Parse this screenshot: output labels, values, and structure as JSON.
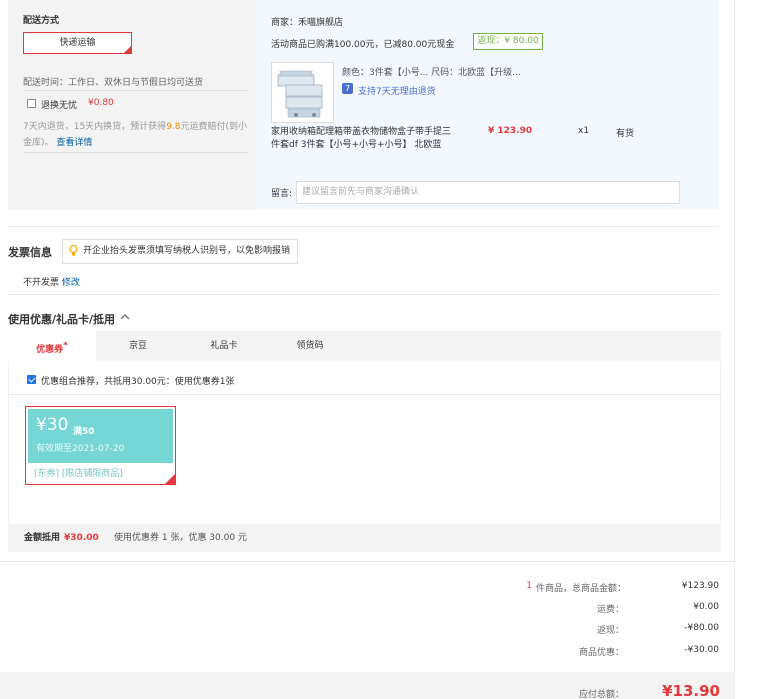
{
  "shipping": {
    "section_title": "配送方式",
    "method_button": "快递运输",
    "delivery_time": "配送时间：工作日、双休日与节假日均可送货",
    "insurance_label": "退换无忧",
    "insurance_price": "¥0.80",
    "insurance_desc_1": "7天内退货，15天内换货，预计获得",
    "insurance_desc_amount": "9.8",
    "insurance_desc_2": "元运费赔付(到小",
    "insurance_desc_3": "金库)。",
    "details_link": "查看详情"
  },
  "order": {
    "merchant_label": "商家：禾喵旗舰店",
    "promo_text": "活动商品已购满100.00元，已减80.00元现金",
    "rebate_tag": "返现：¥ 80.00",
    "spec": "颜色：3件套【小号...  尺码：北欧蓝【升级...",
    "seven_day_icon": "7",
    "seven_day_text": "支持7天无理由退货",
    "product_name_1": "家用收纳箱配理箱带盖衣物储物盒子带手提三",
    "product_name_2": "件套df 3件套【小号+小号+小号】 北欧蓝",
    "price": "¥ 123.90",
    "qty": "x1",
    "stock": "有货",
    "message_label": "留言:",
    "message_placeholder": "建议留言前先与商家沟通确认"
  },
  "invoice": {
    "title": "发票信息",
    "tip": "开企业抬头发票须填写纳税人识别号，以免影响报销",
    "value": "不开发票",
    "edit_link": "修改"
  },
  "discount": {
    "title": "使用优惠/礼品卡/抵用",
    "tabs": [
      "优惠券",
      "京豆",
      "礼品卡",
      "领货码"
    ],
    "combo_text": "优惠组合推荐，共抵用30.00元：使用优惠券1张",
    "coupon": {
      "amount": "¥30",
      "condition": "满50",
      "validity": "有效期至2021-07-20",
      "scope": "[东券] [限店铺限商品]"
    },
    "summary_label": "金额抵用",
    "summary_amount": "¥30.00",
    "summary_detail": "使用优惠券 1 张，优惠 30.00 元"
  },
  "totals": {
    "count": "1",
    "count_label": "件商品，总商品金额：",
    "goods_total": "¥123.90",
    "freight_label": "运费：",
    "freight": "¥0.00",
    "rebate_label": "返现：",
    "rebate": "-¥80.00",
    "promo_label": "商品优惠：",
    "promo": "-¥30.00",
    "payable_label": "应付总额：",
    "payable": "¥13.90"
  },
  "colors": {
    "accent": "#e4393c",
    "link": "#005ea7",
    "coupon": "#76d6d6",
    "green": "#71b247"
  }
}
